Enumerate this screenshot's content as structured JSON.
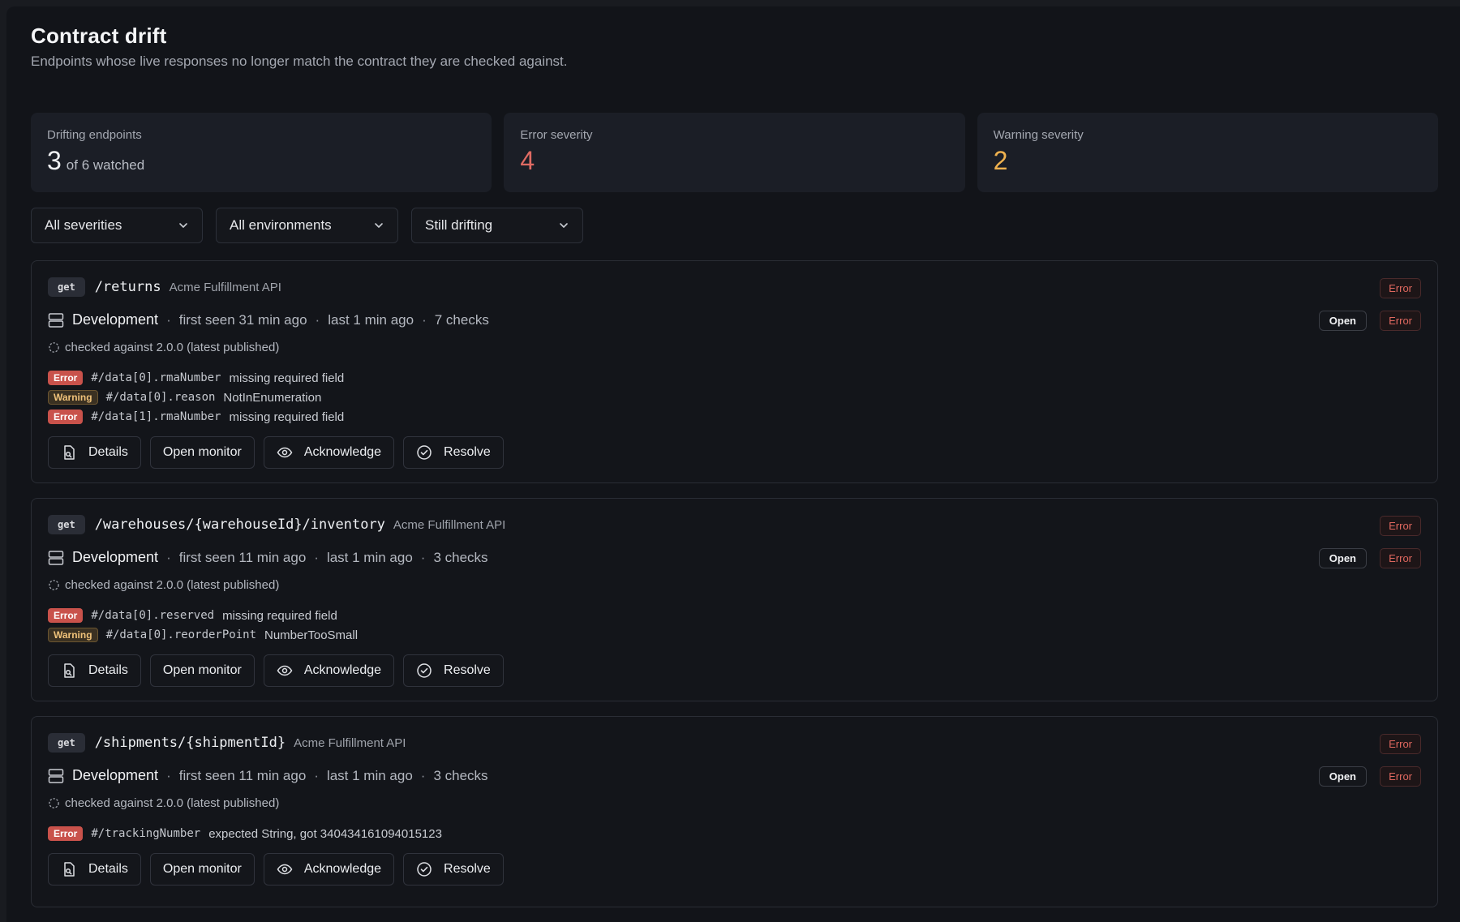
{
  "header": {
    "title": "Contract drift",
    "subtitle": "Endpoints whose live responses no longer match the contract they are checked against."
  },
  "stats": {
    "drifting": {
      "label": "Drifting endpoints",
      "value": "3",
      "sub": "of 6 watched"
    },
    "error": {
      "label": "Error severity",
      "value": "4"
    },
    "warning": {
      "label": "Warning severity",
      "value": "2"
    }
  },
  "filters": {
    "severity": "All severities",
    "environment": "All environments",
    "status": "Still drifting"
  },
  "colors": {
    "error": "#e06b63",
    "warning": "#f0b24f",
    "background": "#121419"
  },
  "icons": [
    "chevron-down-icon",
    "server-icon",
    "spinner-icon",
    "file-search-icon",
    "eye-icon",
    "check-circle-icon"
  ],
  "cards": [
    {
      "method": "get",
      "path": "/returns",
      "api": "Acme Fulfillment API",
      "severity": "Error",
      "env": "Development",
      "first_seen": "first seen 31 min ago",
      "last": "last 1 min ago",
      "checks": "7 checks",
      "status": "Open",
      "status_severity": "Error",
      "checked_against": "checked against 2.0.0 (latest published)",
      "issues": [
        {
          "level": "Error",
          "path": "#/data[0].rmaNumber",
          "msg": "missing required field"
        },
        {
          "level": "Warning",
          "path": "#/data[0].reason",
          "msg": "NotInEnumeration"
        },
        {
          "level": "Error",
          "path": "#/data[1].rmaNumber",
          "msg": "missing required field"
        }
      ],
      "actions": {
        "details": "Details",
        "monitor": "Open monitor",
        "ack": "Acknowledge",
        "resolve": "Resolve"
      }
    },
    {
      "method": "get",
      "path": "/warehouses/{warehouseId}/inventory",
      "api": "Acme Fulfillment API",
      "severity": "Error",
      "env": "Development",
      "first_seen": "first seen 11 min ago",
      "last": "last 1 min ago",
      "checks": "3 checks",
      "status": "Open",
      "status_severity": "Error",
      "checked_against": "checked against 2.0.0 (latest published)",
      "issues": [
        {
          "level": "Error",
          "path": "#/data[0].reserved",
          "msg": "missing required field"
        },
        {
          "level": "Warning",
          "path": "#/data[0].reorderPoint",
          "msg": "NumberTooSmall"
        }
      ],
      "actions": {
        "details": "Details",
        "monitor": "Open monitor",
        "ack": "Acknowledge",
        "resolve": "Resolve"
      }
    },
    {
      "method": "get",
      "path": "/shipments/{shipmentId}",
      "api": "Acme Fulfillment API",
      "severity": "Error",
      "env": "Development",
      "first_seen": "first seen 11 min ago",
      "last": "last 1 min ago",
      "checks": "3 checks",
      "status": "Open",
      "status_severity": "Error",
      "checked_against": "checked against 2.0.0 (latest published)",
      "issues": [
        {
          "level": "Error",
          "path": "#/trackingNumber",
          "msg": "expected String, got 340434161094015123"
        }
      ],
      "actions": {
        "details": "Details",
        "monitor": "Open monitor",
        "ack": "Acknowledge",
        "resolve": "Resolve"
      }
    }
  ]
}
